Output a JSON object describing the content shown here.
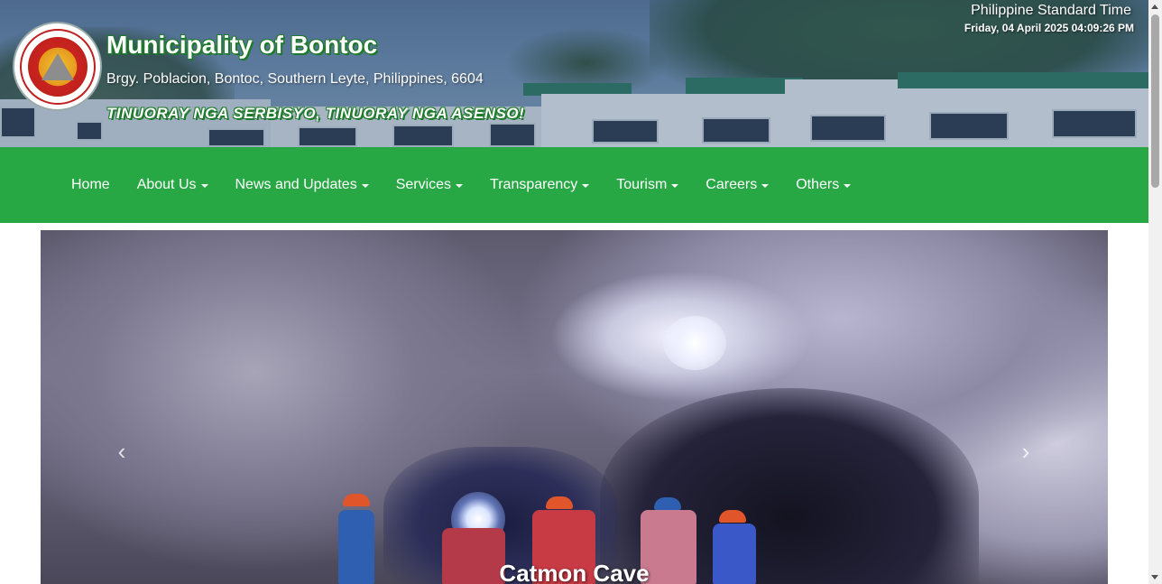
{
  "header": {
    "title": "Municipality of Bontoc",
    "address": "Brgy. Poblacion, Bontoc, Southern Leyte, Philippines, 6604",
    "motto": "TINUORAY NGA SERBISYO, TINUORAY NGA ASENSO!",
    "seal_icon": "municipal-seal",
    "time_label": "Philippine Standard Time",
    "time_value": "Friday, 04 April 2025 04:09:26 PM"
  },
  "nav": {
    "items": [
      {
        "label": "Home",
        "dropdown": false
      },
      {
        "label": "About Us",
        "dropdown": true
      },
      {
        "label": "News and Updates",
        "dropdown": true
      },
      {
        "label": "Services",
        "dropdown": true
      },
      {
        "label": "Transparency",
        "dropdown": true
      },
      {
        "label": "Tourism",
        "dropdown": true
      },
      {
        "label": "Careers",
        "dropdown": true
      },
      {
        "label": "Others",
        "dropdown": true
      }
    ],
    "color": "#28a745"
  },
  "carousel": {
    "caption": "Catmon Cave",
    "prev_icon": "chevron-left-icon",
    "next_icon": "chevron-right-icon"
  },
  "colors": {
    "accent_green": "#28a745",
    "title_outline": "#1c7a2a"
  }
}
